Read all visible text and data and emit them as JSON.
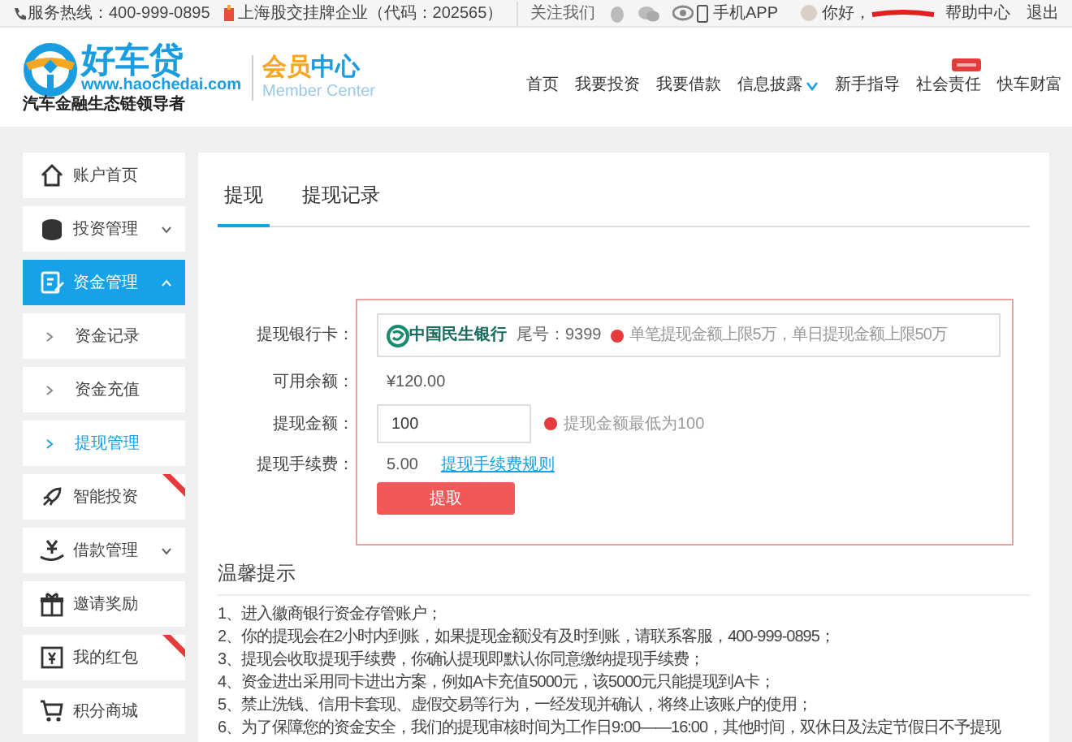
{
  "top_bar": {
    "hotline": "服务热线：400-999-0895",
    "listing": "上海股交挂牌企业（代码：202565）",
    "follow": "关注我们",
    "app": "手机APP",
    "greeting": "你好，",
    "help": "帮助中心",
    "logout": "退出"
  },
  "header": {
    "logo": {
      "name": "好车贷",
      "url": "www.haochedai.com",
      "slogan": "汽车金融生态链领导者"
    },
    "member_center": {
      "part_1": "会员",
      "part_2": "中心",
      "subtitle": "Member Center"
    },
    "nav": [
      {
        "label": "首页"
      },
      {
        "label": "我要投资"
      },
      {
        "label": "我要借款"
      },
      {
        "label": "信息披露",
        "dropdown": true
      },
      {
        "label": "新手指导"
      },
      {
        "label": "社会责任",
        "badge": true
      },
      {
        "label": "快车财富"
      }
    ]
  },
  "sidebar": {
    "items": [
      {
        "label": "账户首页",
        "kind": "main",
        "selected": false
      },
      {
        "label": "投资管理",
        "kind": "main",
        "selected": false,
        "expanded": false
      },
      {
        "label": "资金管理",
        "kind": "main",
        "selected": true,
        "expanded": true
      },
      {
        "label": "资金记录",
        "kind": "sub",
        "selected": false
      },
      {
        "label": "资金充值",
        "kind": "sub",
        "selected": false
      },
      {
        "label": "提现管理",
        "kind": "sub",
        "selected": true
      },
      {
        "label": "智能投资",
        "kind": "main",
        "selected": false,
        "badge": true
      },
      {
        "label": "借款管理",
        "kind": "main",
        "selected": false,
        "expanded": false
      },
      {
        "label": "邀请奖励",
        "kind": "main",
        "selected": false
      },
      {
        "label": "我的红包",
        "kind": "main",
        "selected": false,
        "badge": true
      },
      {
        "label": "积分商城",
        "kind": "main",
        "selected": false
      }
    ]
  },
  "tabs": [
    {
      "label": "提现",
      "selected": true
    },
    {
      "label": "提现记录",
      "selected": false
    }
  ],
  "form": {
    "bank_card": {
      "label": "提现银行卡：",
      "bank_name": "中国民生银行",
      "tail": "尾号：9399",
      "note": "单笔提现金额上限5万，单日提现金额上限50万"
    },
    "balance": {
      "label": "可用余额：",
      "value": "¥120.00"
    },
    "amount": {
      "label": "提现金额：",
      "value": "100",
      "note": "提现金额最低为100"
    },
    "fee": {
      "label": "提现手续费：",
      "value": "5.00",
      "link": "提现手续费规则"
    },
    "submit": "提取"
  },
  "tips": {
    "title": "温馨提示",
    "items": [
      "1、进入徽商银行资金存管账户；",
      "2、你的提现会在2小时内到账，如果提现金额没有及时到账，请联系客服，400-999-0895；",
      "3、提现会收取提现手续费，你确认提现即默认你同意缴纳提现手续费；",
      "4、资金进出采用同卡进出方案，例如A卡充值5000元，该5000元只能提现到A卡；",
      "5、禁止洗钱、信用卡套现、虚假交易等行为，一经发现并确认，将终止该账户的使用；",
      "6、为了保障您的资金安全，我们的提现审核时间为工作日9:00——16:00，其他时间，双休日及法定节假日不予提现"
    ]
  }
}
